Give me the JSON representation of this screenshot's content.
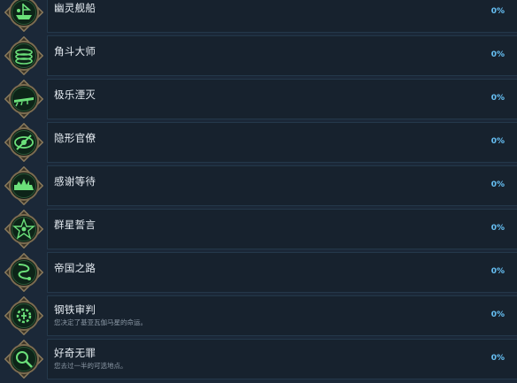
{
  "achievements": [
    {
      "title": "幽灵舰船",
      "desc": "",
      "percent": "0%",
      "icon": "ghost-ship-icon"
    },
    {
      "title": "角斗大师",
      "desc": "",
      "percent": "0%",
      "icon": "arena-rings-icon"
    },
    {
      "title": "极乐湮灭",
      "desc": "",
      "percent": "0%",
      "icon": "cannon-icon"
    },
    {
      "title": "隐形官僚",
      "desc": "",
      "percent": "0%",
      "icon": "slashed-eye-icon"
    },
    {
      "title": "感谢等待",
      "desc": "",
      "percent": "0%",
      "icon": "fleet-icon"
    },
    {
      "title": "群星誓言",
      "desc": "",
      "percent": "0%",
      "icon": "star-emblem-icon"
    },
    {
      "title": "帝国之路",
      "desc": "",
      "percent": "0%",
      "icon": "serpent-path-icon"
    },
    {
      "title": "钢铁审判",
      "desc": "您决定了基亚瓦伽马星的命运。",
      "percent": "0%",
      "icon": "iron-gear-icon"
    },
    {
      "title": "好奇无罪",
      "desc": "您去过一半的可选地点。",
      "percent": "0%",
      "icon": "magnifier-icon"
    }
  ],
  "colors": {
    "background": "#1b2838",
    "card": "#17222e",
    "percent": "#67c1f5",
    "badge_glow": "#6be07a",
    "badge_frame": "#8a7a5c"
  }
}
